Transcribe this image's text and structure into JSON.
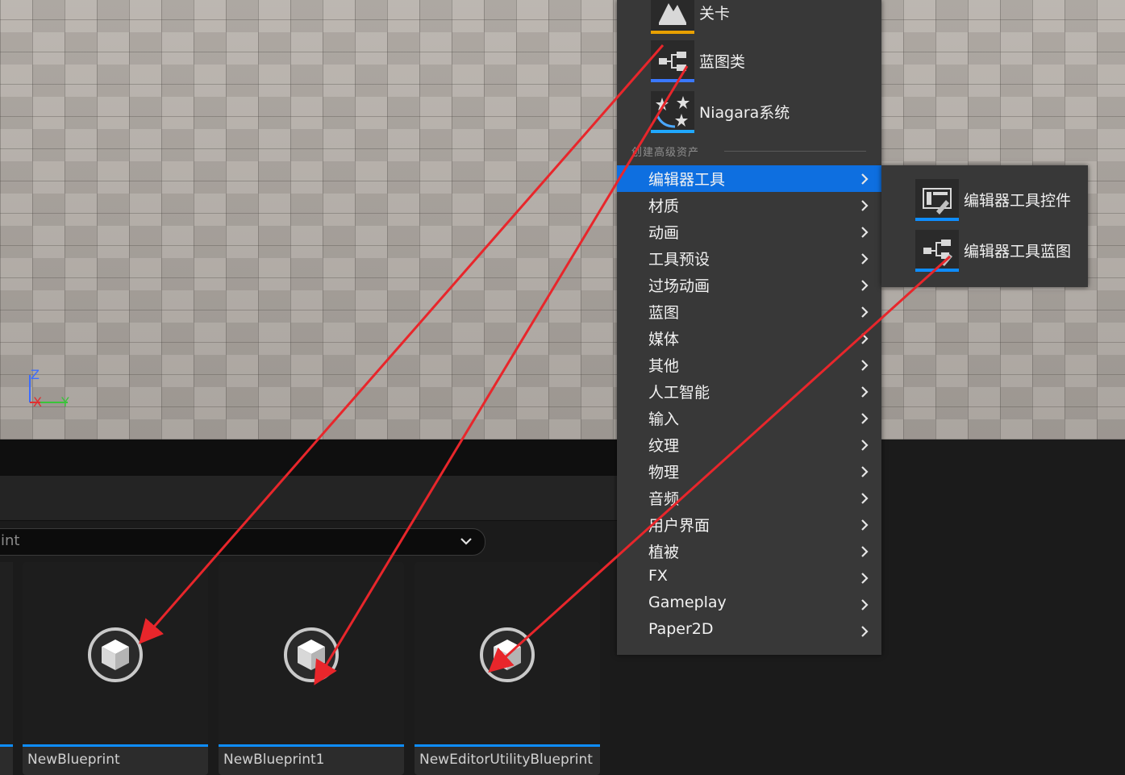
{
  "viewport": {
    "axis": {
      "z": "Z",
      "x": "X",
      "y": "Y"
    }
  },
  "content_browser": {
    "filter_text": "int",
    "assets": [
      {
        "name": "NewBlueprint"
      },
      {
        "name": "NewBlueprint1"
      },
      {
        "name": "NewEditorUtilityBlueprint"
      }
    ]
  },
  "menu": {
    "tiles": [
      {
        "label": "关卡",
        "icon": "level-icon",
        "color": "#e8a000"
      },
      {
        "label": "蓝图类",
        "icon": "blueprint-class-icon",
        "color": "#3a78ff"
      },
      {
        "label": "Niagara系统",
        "icon": "niagara-icon",
        "color": "#20a8ff"
      }
    ],
    "section_header": "创建高级资产",
    "items": [
      {
        "label": "编辑器工具"
      },
      {
        "label": "材质"
      },
      {
        "label": "动画"
      },
      {
        "label": "工具预设"
      },
      {
        "label": "过场动画"
      },
      {
        "label": "蓝图"
      },
      {
        "label": "媒体"
      },
      {
        "label": "其他"
      },
      {
        "label": "人工智能"
      },
      {
        "label": "输入"
      },
      {
        "label": "纹理"
      },
      {
        "label": "物理"
      },
      {
        "label": "音频"
      },
      {
        "label": "用户界面"
      },
      {
        "label": "植被"
      },
      {
        "label": "FX"
      },
      {
        "label": "Gameplay"
      },
      {
        "label": "Paper2D"
      }
    ],
    "active_index": 0
  },
  "submenu": {
    "tiles": [
      {
        "label": "编辑器工具控件",
        "icon": "editor-widget-icon",
        "color": "#0e8dff"
      },
      {
        "label": "编辑器工具蓝图",
        "icon": "editor-blueprint-icon",
        "color": "#0e8dff"
      }
    ]
  },
  "colors": {
    "accent": "#0e6fe0",
    "annotation_arrow": "#e8262b"
  }
}
